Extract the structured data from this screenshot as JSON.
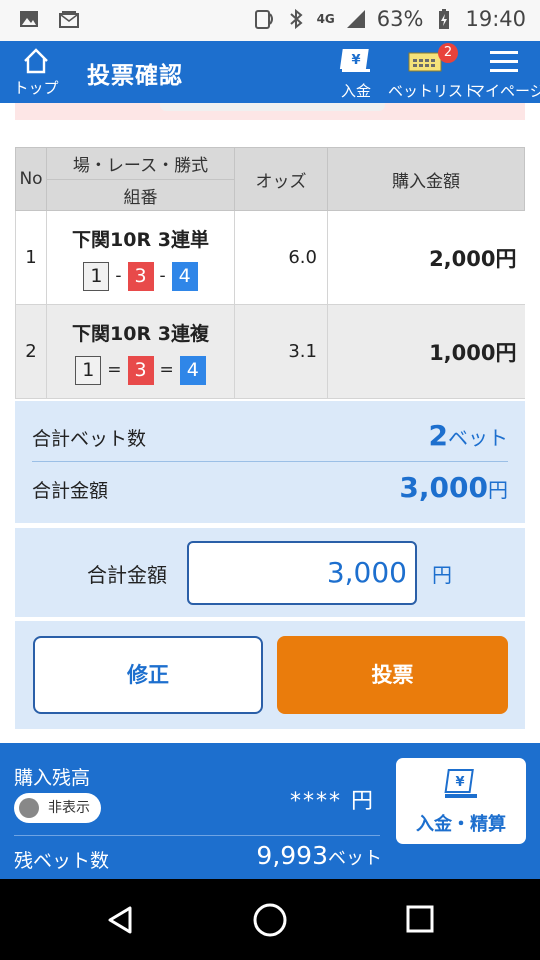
{
  "status_bar": {
    "network": "4G",
    "battery": "63%",
    "time": "19:40"
  },
  "header": {
    "home_label": "トップ",
    "title": "投票確認",
    "deposit_label": "入金",
    "betlist_label": "ベットリスト",
    "betlist_badge": "2",
    "mypage_label": "マイページ"
  },
  "table": {
    "headers": {
      "no": "No",
      "race": "場・レース・勝式",
      "combo": "組番",
      "odds": "オッズ",
      "amount": "購入金額"
    },
    "rows": [
      {
        "no": "1",
        "race": "下関10R 3連単",
        "combo": [
          "1",
          "3",
          "4"
        ],
        "sep": "-",
        "odds": "6.0",
        "amount": "2,000円"
      },
      {
        "no": "2",
        "race": "下関10R 3連複",
        "combo": [
          "1",
          "3",
          "4"
        ],
        "sep": "=",
        "odds": "3.1",
        "amount": "1,000円"
      }
    ]
  },
  "summary": {
    "bets_label": "合計ベット数",
    "bets_value": "2",
    "bets_unit": "ベット",
    "total_label": "合計金額",
    "total_value": "3,000",
    "total_unit": "円"
  },
  "confirm": {
    "label": "合計金額",
    "value": "3,000",
    "unit": "円"
  },
  "buttons": {
    "fix": "修正",
    "vote": "投票"
  },
  "footer": {
    "balance_label": "購入残高",
    "toggle_label": "非表示",
    "balance_value": "****",
    "balance_unit": "円",
    "remain_label": "残ベット数",
    "remain_value": "9,993",
    "remain_unit": "ベット",
    "deposit_label": "入金・精算"
  },
  "colors": {
    "primary": "#1d6fce",
    "accent": "#ea7c0c",
    "box_red": "#e84a4a",
    "box_blue": "#2f86e8"
  }
}
